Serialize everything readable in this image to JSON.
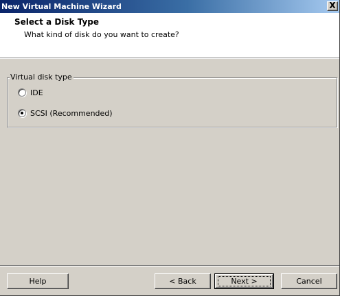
{
  "window": {
    "title": "New Virtual Machine Wizard",
    "close_label": "X"
  },
  "header": {
    "title": "Select a Disk Type",
    "subtitle": "What kind of disk do you want to create?"
  },
  "disk_type": {
    "legend": "Virtual disk type",
    "options": [
      {
        "label": "IDE",
        "checked": false
      },
      {
        "label": "SCSI (Recommended)",
        "checked": true
      }
    ]
  },
  "buttons": {
    "help": "Help",
    "back": "< Back",
    "next": "Next >",
    "cancel": "Cancel"
  }
}
